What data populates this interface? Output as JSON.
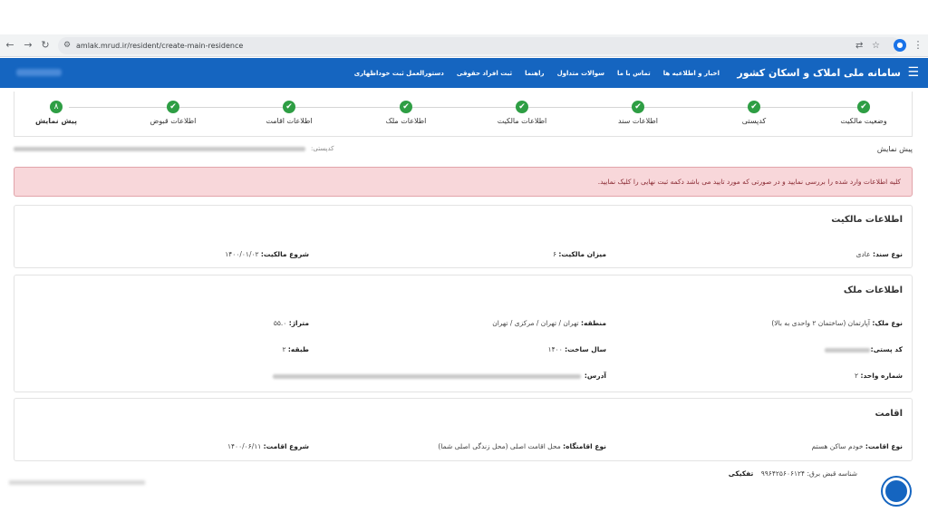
{
  "browser": {
    "url": "amlak.mrud.ir/resident/create-main-residence"
  },
  "header": {
    "app_title": "سامانه ملی املاک و اسکان کشور",
    "menu": [
      "اخبار و اطلاعیه ها",
      "تماس با ما",
      "سوالات متداول",
      "راهنما",
      "ثبت افراد حقوقی",
      "دستورالعمل ثبت خوداظهاری"
    ]
  },
  "steps": [
    {
      "label": "وضعیت مالکیت",
      "mark": "✔"
    },
    {
      "label": "کدپستی",
      "mark": "✔"
    },
    {
      "label": "اطلاعات سند",
      "mark": "✔"
    },
    {
      "label": "اطلاعات مالکیت",
      "mark": "✔"
    },
    {
      "label": "اطلاعات ملک",
      "mark": "✔"
    },
    {
      "label": "اطلاعات اقامت",
      "mark": "✔"
    },
    {
      "label": "اطلاعات قبوض",
      "mark": "✔"
    },
    {
      "label": "پیش نمایش",
      "mark": "۸"
    }
  ],
  "breadcrumb": {
    "title": "پیش نمایش",
    "code_label": "کدپستی:"
  },
  "alert": {
    "text": "کلیه اطلاعات وارد شده را بررسی نمایید و در صورتی که مورد تایید می باشد دکمه ثبت نهایی را کلیک نمایید."
  },
  "ownership": {
    "title": "اطلاعات مالکیت",
    "doc_type_label": "نوع سند:",
    "doc_type_value": "عادی",
    "share_label": "میزان مالکیت:",
    "share_value": "۶",
    "start_label": "شروع مالکیت:",
    "start_value": "۱۴۰۰/۰۱/۰۲"
  },
  "property": {
    "title": "اطلاعات ملک",
    "type_label": "نوع ملک:",
    "type_value": "آپارتمان (ساختمان ۲ واحدی به بالا)",
    "region_label": "منطقه:",
    "region_value": "تهران / تهران / مرکزی / تهران",
    "area_label": "متراژ:",
    "area_value": "۵۵.۰",
    "postal_label": "کد پستی:",
    "year_label": "سال ساخت:",
    "year_value": "۱۴۰۰",
    "floor_label": "طبقه:",
    "floor_value": "۲",
    "unit_label": "شماره واحد:",
    "unit_value": "۲",
    "address_label": "آدرس:"
  },
  "residence": {
    "title": "اقامت",
    "type_label": "نوع اقامت:",
    "type_value": "خودم ساکن هستم",
    "place_label": "نوع اقامتگاه:",
    "place_value": "محل اقامت اصلی (محل زندگی اصلی شما)",
    "start_label": "شروع اقامت:",
    "start_value": "۱۴۰۰/۰۶/۱۱"
  },
  "footer": {
    "bill_label": "شناسه قبض برق:",
    "bill_value": "۹۹۶۴۲۵۶۰۶۱۲۴",
    "tag": "تفکیکی"
  }
}
